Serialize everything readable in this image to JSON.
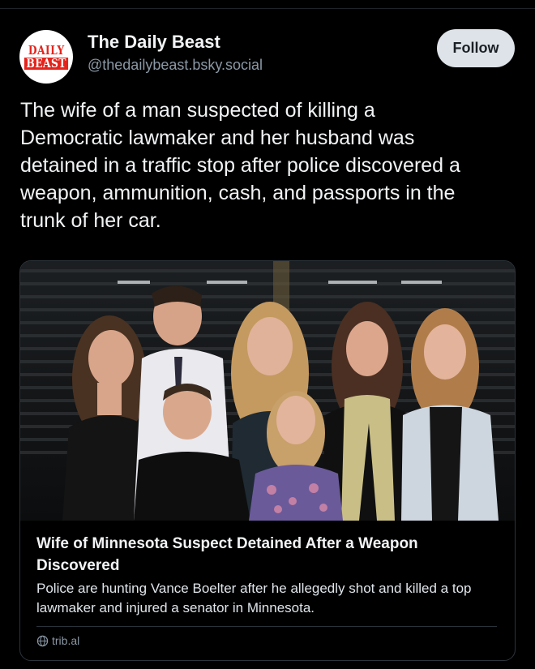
{
  "post": {
    "author": {
      "display_name": "The Daily Beast",
      "handle": "@thedailybeast.bsky.social",
      "avatar_logo": [
        "DAILY",
        "BEAST"
      ]
    },
    "follow_label": "Follow",
    "text": "The wife of a man suspected of killing a\nDemocratic lawmaker and her husband was\ndetained in a traffic stop after police discovered a\nweapon, ammunition, cash, and passports in the\ntrunk of her car.",
    "link_card": {
      "title": "Wife of Minnesota Suspect Detained After a Weapon Discovered",
      "description": "Police are hunting Vance Boelter after he allegedly shot and killed a top lawmaker and injured a senator in Minnesota.",
      "domain": "trib.al",
      "domain_icon": "globe-icon"
    }
  },
  "colors": {
    "background": "#000000",
    "text_primary": "#f1f3f5",
    "text_secondary": "#8b98a5",
    "follow_button_bg": "#dde3e8",
    "card_border": "#2c343b",
    "brand_red": "#e4241c"
  }
}
